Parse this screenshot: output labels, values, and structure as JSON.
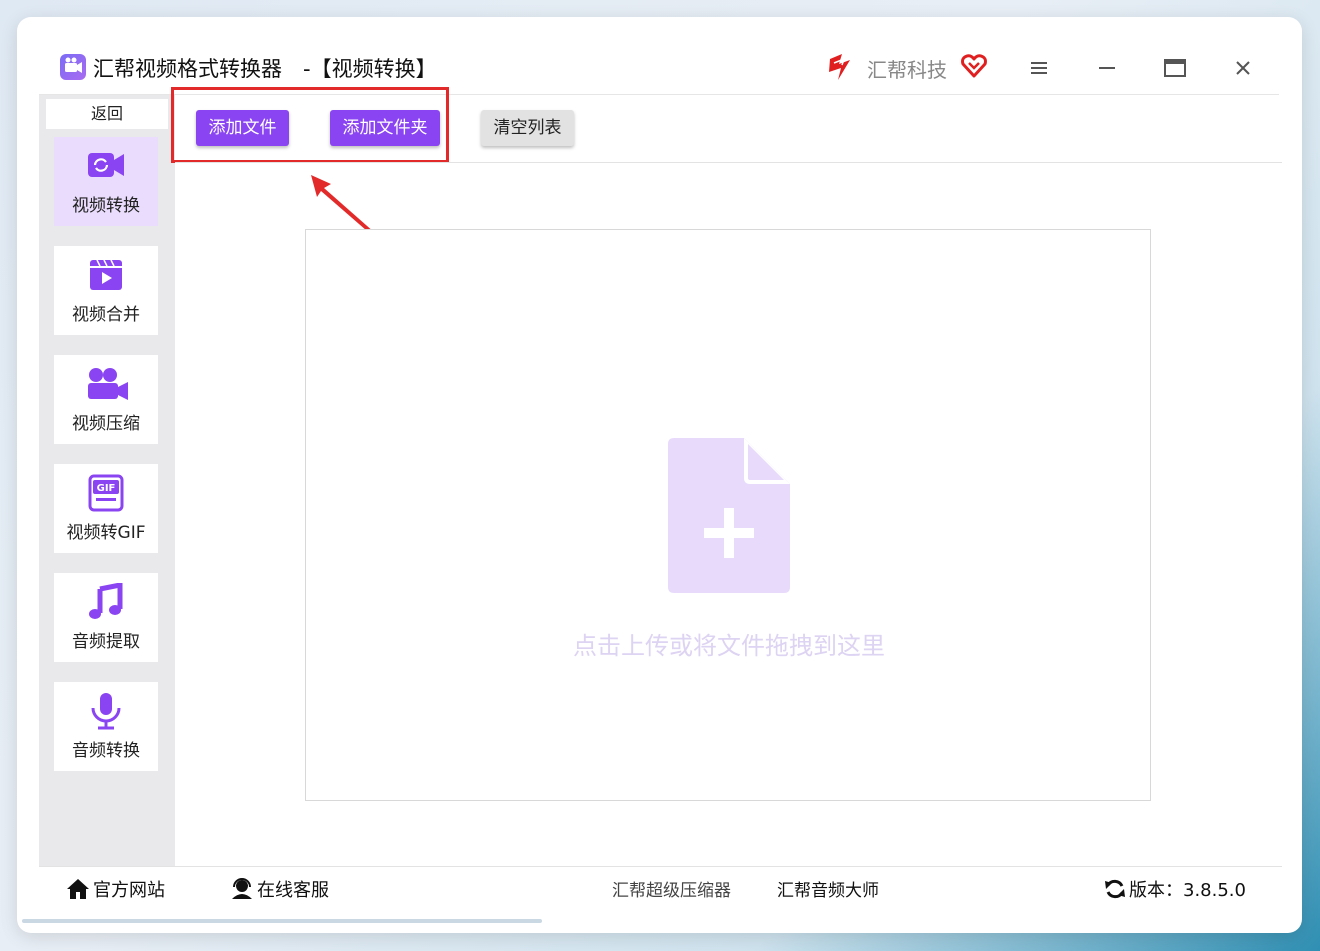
{
  "window": {
    "title": "汇帮视频格式转换器　-【视频转换】",
    "brand": "汇帮科技"
  },
  "sidebar": {
    "back_label": "返回",
    "items": [
      {
        "label": "视频转换",
        "icon": "video-convert-icon",
        "active": true
      },
      {
        "label": "视频合并",
        "icon": "video-merge-icon",
        "active": false
      },
      {
        "label": "视频压缩",
        "icon": "video-compress-icon",
        "active": false
      },
      {
        "label": "视频转GIF",
        "icon": "gif-icon",
        "active": false
      },
      {
        "label": "音频提取",
        "icon": "music-note-icon",
        "active": false
      },
      {
        "label": "音频转换",
        "icon": "microphone-icon",
        "active": false
      }
    ]
  },
  "toolbar": {
    "add_file": "添加文件",
    "add_folder": "添加文件夹",
    "clear_list": "清空列表"
  },
  "dropzone": {
    "hint": "点击上传或将文件拖拽到这里"
  },
  "footer": {
    "website": "官方网站",
    "support": "在线客服",
    "product1": "汇帮超级压缩器",
    "product2": "汇帮音频大师",
    "version": "版本：3.8.5.0"
  },
  "colors": {
    "accent": "#8a44f2",
    "active_bg": "#e9dcfc",
    "highlight": "#e32a2a"
  }
}
